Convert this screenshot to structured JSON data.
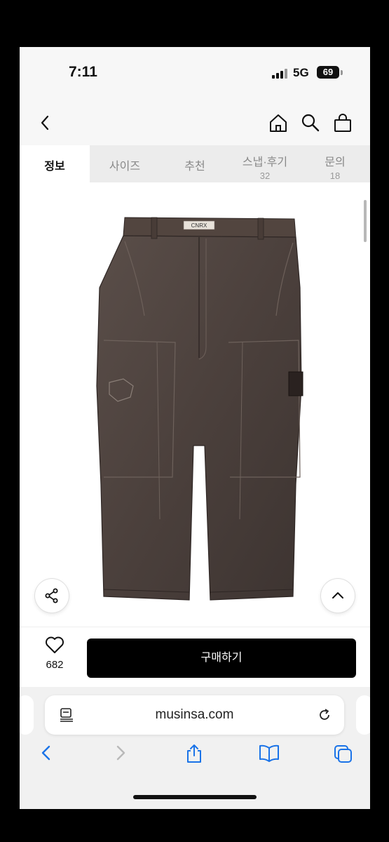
{
  "status": {
    "time": "7:11",
    "network": "5G",
    "battery": "69"
  },
  "header": {
    "icons": [
      "back-icon",
      "home-icon",
      "search-icon",
      "bag-icon"
    ]
  },
  "tabs": [
    {
      "label": "정보",
      "active": true
    },
    {
      "label": "사이즈"
    },
    {
      "label": "추천"
    },
    {
      "label": "스냅·후기",
      "count": "32"
    },
    {
      "label": "문의",
      "count": "18"
    }
  ],
  "product": {
    "image": "brown-wide-cargo-pants",
    "label_tag": "CNRX"
  },
  "buy_bar": {
    "like_count": "682",
    "buy_label": "구매하기"
  },
  "browser": {
    "url": "musinsa.com"
  },
  "colors": {
    "accent": "#000000",
    "safari_blue": "#1a73e8",
    "pants": "#4a403c"
  }
}
